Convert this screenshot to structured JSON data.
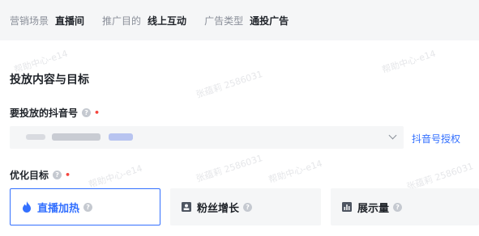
{
  "campaign_meta": [
    {
      "label": "营销场景",
      "value": "直播间"
    },
    {
      "label": "推广目的",
      "value": "线上互动"
    },
    {
      "label": "广告类型",
      "value": "通投广告"
    }
  ],
  "section": {
    "title": "投放内容与目标"
  },
  "account_field": {
    "label": "要投放的抖音号",
    "help": "?",
    "required": "•",
    "auth_link": "抖音号授权"
  },
  "goal_field": {
    "label": "优化目标",
    "help": "?",
    "required": "•",
    "options": [
      {
        "label": "直播加热",
        "icon": "flame-icon",
        "selected": true
      },
      {
        "label": "粉丝增长",
        "icon": "person-card-icon",
        "selected": false
      },
      {
        "label": "展示量",
        "icon": "bar-chart-icon",
        "selected": false
      }
    ]
  },
  "watermarks": [
    "帮助中心-e14",
    "张蕴莉 2586031"
  ],
  "colors": {
    "accent": "#3370ff",
    "required": "#f5453d",
    "panel_bg": "#f5f6f7"
  }
}
